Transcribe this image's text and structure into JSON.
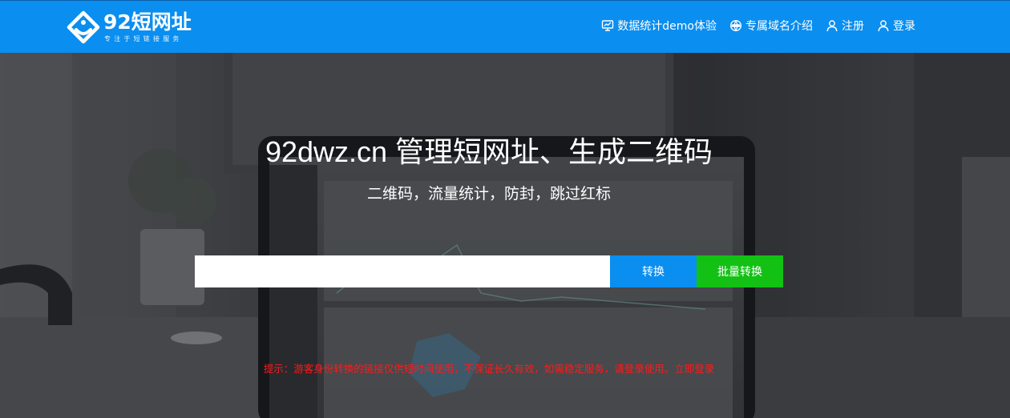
{
  "header": {
    "logo": {
      "title": "92短网址",
      "subtitle": "专注于短链接服务"
    },
    "nav": [
      {
        "label": "数据统计demo体验",
        "icon": "chart-monitor-icon"
      },
      {
        "label": "专属域名介绍",
        "icon": "globe-icon"
      },
      {
        "label": "注册",
        "icon": "user-icon"
      },
      {
        "label": "登录",
        "icon": "user-icon"
      }
    ]
  },
  "hero": {
    "title": "92dwz.cn 管理短网址、生成二维码",
    "subtitle": "二维码，流量统计，防封，跳过红标",
    "input": {
      "value": "",
      "placeholder": ""
    },
    "convert_label": "转换",
    "batch_label": "批量转换",
    "tip": {
      "text": "提示：游客身份转换的链接仅供短时间使用，不保证长久有效，如需稳定服务，请登录使用。",
      "link": "立即登录"
    }
  },
  "colors": {
    "brand": "#0a8ef0",
    "batch": "#12c114",
    "tip": "#ff1a1a"
  }
}
